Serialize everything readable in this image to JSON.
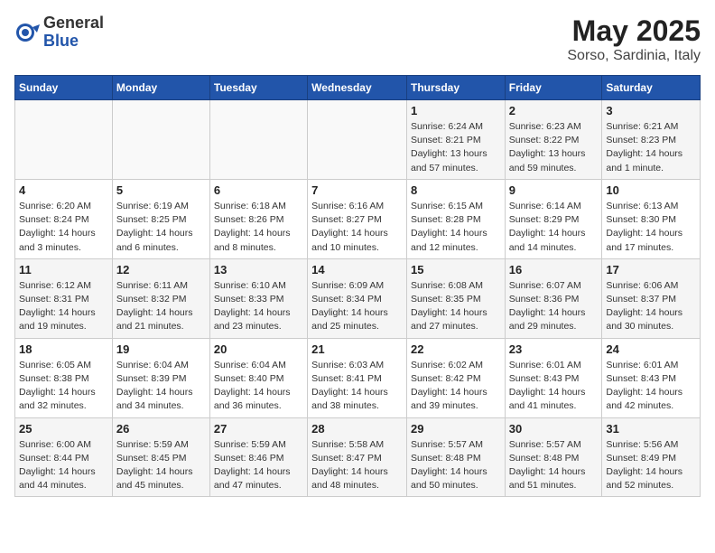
{
  "header": {
    "logo_general": "General",
    "logo_blue": "Blue",
    "title": "May 2025",
    "subtitle": "Sorso, Sardinia, Italy"
  },
  "days_of_week": [
    "Sunday",
    "Monday",
    "Tuesday",
    "Wednesday",
    "Thursday",
    "Friday",
    "Saturday"
  ],
  "weeks": [
    [
      {
        "day": "",
        "info": ""
      },
      {
        "day": "",
        "info": ""
      },
      {
        "day": "",
        "info": ""
      },
      {
        "day": "",
        "info": ""
      },
      {
        "day": "1",
        "info": "Sunrise: 6:24 AM\nSunset: 8:21 PM\nDaylight: 13 hours and 57 minutes."
      },
      {
        "day": "2",
        "info": "Sunrise: 6:23 AM\nSunset: 8:22 PM\nDaylight: 13 hours and 59 minutes."
      },
      {
        "day": "3",
        "info": "Sunrise: 6:21 AM\nSunset: 8:23 PM\nDaylight: 14 hours and 1 minute."
      }
    ],
    [
      {
        "day": "4",
        "info": "Sunrise: 6:20 AM\nSunset: 8:24 PM\nDaylight: 14 hours and 3 minutes."
      },
      {
        "day": "5",
        "info": "Sunrise: 6:19 AM\nSunset: 8:25 PM\nDaylight: 14 hours and 6 minutes."
      },
      {
        "day": "6",
        "info": "Sunrise: 6:18 AM\nSunset: 8:26 PM\nDaylight: 14 hours and 8 minutes."
      },
      {
        "day": "7",
        "info": "Sunrise: 6:16 AM\nSunset: 8:27 PM\nDaylight: 14 hours and 10 minutes."
      },
      {
        "day": "8",
        "info": "Sunrise: 6:15 AM\nSunset: 8:28 PM\nDaylight: 14 hours and 12 minutes."
      },
      {
        "day": "9",
        "info": "Sunrise: 6:14 AM\nSunset: 8:29 PM\nDaylight: 14 hours and 14 minutes."
      },
      {
        "day": "10",
        "info": "Sunrise: 6:13 AM\nSunset: 8:30 PM\nDaylight: 14 hours and 17 minutes."
      }
    ],
    [
      {
        "day": "11",
        "info": "Sunrise: 6:12 AM\nSunset: 8:31 PM\nDaylight: 14 hours and 19 minutes."
      },
      {
        "day": "12",
        "info": "Sunrise: 6:11 AM\nSunset: 8:32 PM\nDaylight: 14 hours and 21 minutes."
      },
      {
        "day": "13",
        "info": "Sunrise: 6:10 AM\nSunset: 8:33 PM\nDaylight: 14 hours and 23 minutes."
      },
      {
        "day": "14",
        "info": "Sunrise: 6:09 AM\nSunset: 8:34 PM\nDaylight: 14 hours and 25 minutes."
      },
      {
        "day": "15",
        "info": "Sunrise: 6:08 AM\nSunset: 8:35 PM\nDaylight: 14 hours and 27 minutes."
      },
      {
        "day": "16",
        "info": "Sunrise: 6:07 AM\nSunset: 8:36 PM\nDaylight: 14 hours and 29 minutes."
      },
      {
        "day": "17",
        "info": "Sunrise: 6:06 AM\nSunset: 8:37 PM\nDaylight: 14 hours and 30 minutes."
      }
    ],
    [
      {
        "day": "18",
        "info": "Sunrise: 6:05 AM\nSunset: 8:38 PM\nDaylight: 14 hours and 32 minutes."
      },
      {
        "day": "19",
        "info": "Sunrise: 6:04 AM\nSunset: 8:39 PM\nDaylight: 14 hours and 34 minutes."
      },
      {
        "day": "20",
        "info": "Sunrise: 6:04 AM\nSunset: 8:40 PM\nDaylight: 14 hours and 36 minutes."
      },
      {
        "day": "21",
        "info": "Sunrise: 6:03 AM\nSunset: 8:41 PM\nDaylight: 14 hours and 38 minutes."
      },
      {
        "day": "22",
        "info": "Sunrise: 6:02 AM\nSunset: 8:42 PM\nDaylight: 14 hours and 39 minutes."
      },
      {
        "day": "23",
        "info": "Sunrise: 6:01 AM\nSunset: 8:43 PM\nDaylight: 14 hours and 41 minutes."
      },
      {
        "day": "24",
        "info": "Sunrise: 6:01 AM\nSunset: 8:43 PM\nDaylight: 14 hours and 42 minutes."
      }
    ],
    [
      {
        "day": "25",
        "info": "Sunrise: 6:00 AM\nSunset: 8:44 PM\nDaylight: 14 hours and 44 minutes."
      },
      {
        "day": "26",
        "info": "Sunrise: 5:59 AM\nSunset: 8:45 PM\nDaylight: 14 hours and 45 minutes."
      },
      {
        "day": "27",
        "info": "Sunrise: 5:59 AM\nSunset: 8:46 PM\nDaylight: 14 hours and 47 minutes."
      },
      {
        "day": "28",
        "info": "Sunrise: 5:58 AM\nSunset: 8:47 PM\nDaylight: 14 hours and 48 minutes."
      },
      {
        "day": "29",
        "info": "Sunrise: 5:57 AM\nSunset: 8:48 PM\nDaylight: 14 hours and 50 minutes."
      },
      {
        "day": "30",
        "info": "Sunrise: 5:57 AM\nSunset: 8:48 PM\nDaylight: 14 hours and 51 minutes."
      },
      {
        "day": "31",
        "info": "Sunrise: 5:56 AM\nSunset: 8:49 PM\nDaylight: 14 hours and 52 minutes."
      }
    ]
  ]
}
